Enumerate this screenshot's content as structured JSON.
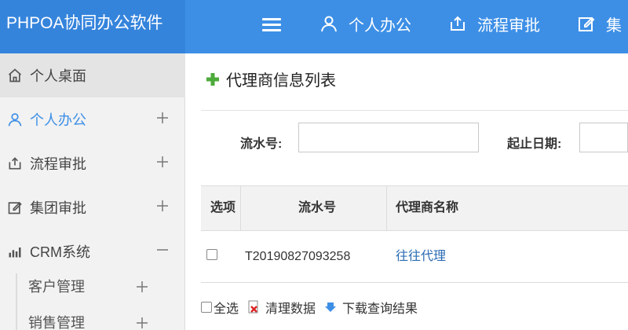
{
  "app": {
    "brand": "PHPOA协同办公软件"
  },
  "topnav": [
    {
      "label": "个人办公",
      "icon": "user-icon"
    },
    {
      "label": "流程审批",
      "icon": "workflow-icon"
    },
    {
      "label": "集",
      "icon": "edit-icon"
    }
  ],
  "sidebar": {
    "items": [
      {
        "label": "个人桌面",
        "icon": "home-icon",
        "toggle": ""
      },
      {
        "label": "个人办公",
        "icon": "user-icon",
        "toggle": "+"
      },
      {
        "label": "流程审批",
        "icon": "workflow-icon",
        "toggle": "+"
      },
      {
        "label": "集团审批",
        "icon": "edit-icon",
        "toggle": "+"
      },
      {
        "label": "CRM系统",
        "icon": "bar-chart-icon",
        "toggle": "−"
      }
    ],
    "sub_items": [
      {
        "label": "客户管理",
        "toggle": "+"
      },
      {
        "label": "销售管理",
        "toggle": "+"
      }
    ]
  },
  "main": {
    "title": "代理商信息列表",
    "search": {
      "serial_label": "流水号:",
      "serial_value": "",
      "date_label": "起止日期:",
      "date_value": ""
    },
    "table": {
      "headers": [
        "选项",
        "流水号",
        "代理商名称"
      ],
      "rows": [
        {
          "serial": "T20190827093258",
          "name": "往往代理"
        }
      ]
    },
    "actions": {
      "select_all": "全选",
      "clear": "清理数据",
      "download": "下载查询结果"
    }
  },
  "colors": {
    "topbar": "#3d8fe6",
    "brand_bg": "#3584dc",
    "sidebar_bg": "#f2f2f2",
    "accent": "#3d8fe6",
    "link": "#2a6cb3"
  }
}
